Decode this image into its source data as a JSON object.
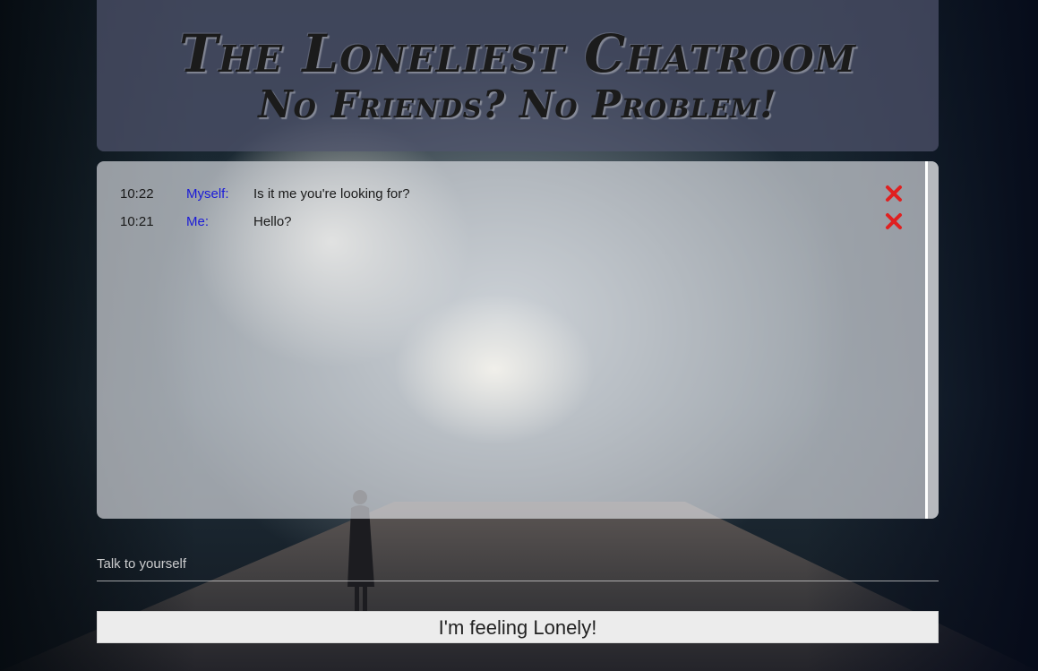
{
  "header": {
    "title": "The Loneliest Chatroom",
    "subtitle": "No Friends? No Problem!"
  },
  "messages": [
    {
      "time": "10:22",
      "author": "Myself:",
      "text": "Is it me you're looking for?",
      "delete_icon": "close-icon"
    },
    {
      "time": "10:21",
      "author": "Me:",
      "text": "Hello?",
      "delete_icon": "close-icon"
    }
  ],
  "input": {
    "placeholder": "Talk to yourself",
    "value": ""
  },
  "button": {
    "label": "I'm feeling Lonely!"
  },
  "colors": {
    "author_link": "#1a1ad8",
    "delete_x": "#e02020",
    "header_bg": "#50556e"
  }
}
